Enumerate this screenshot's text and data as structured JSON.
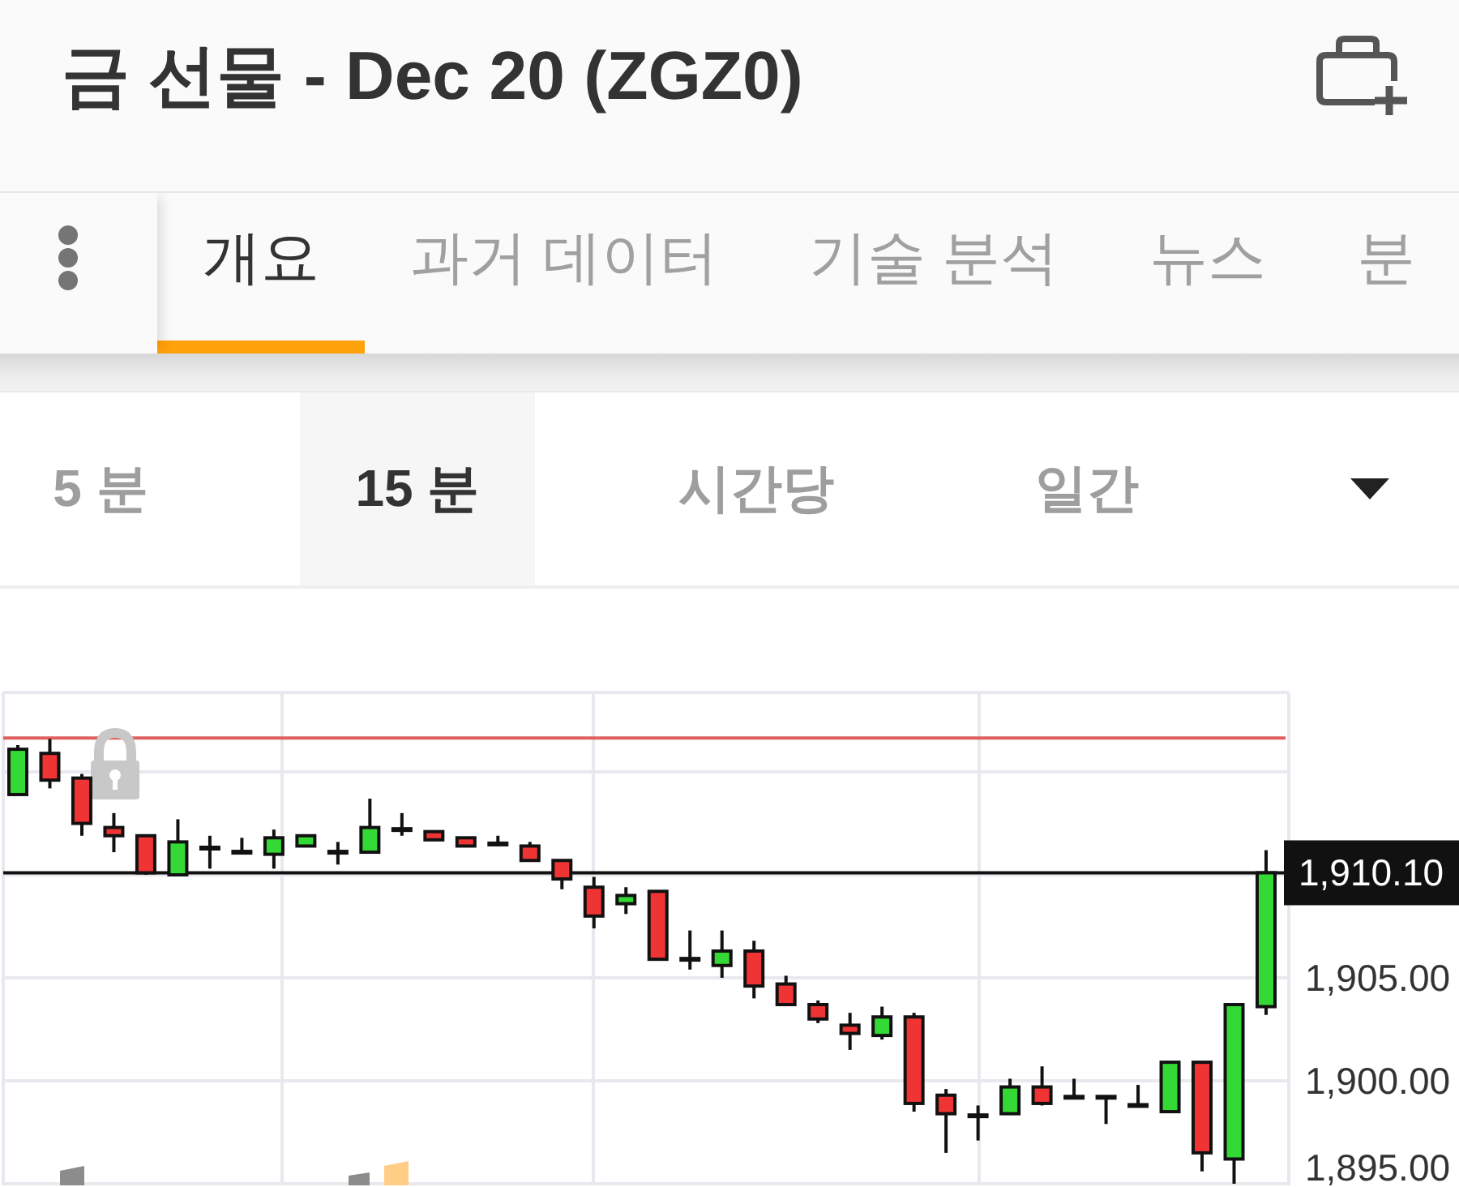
{
  "header": {
    "title": "금 선물 - Dec 20 (ZGZ0)"
  },
  "tabs": [
    {
      "label": "개요",
      "selected": true
    },
    {
      "label": "과거 데이터",
      "selected": false
    },
    {
      "label": "기술 분석",
      "selected": false
    },
    {
      "label": "뉴스",
      "selected": false
    },
    {
      "label": "분",
      "selected": false
    }
  ],
  "intervals": [
    {
      "label": "5 분",
      "selected": false
    },
    {
      "label": "15 분",
      "selected": true
    },
    {
      "label": "시간당",
      "selected": false
    },
    {
      "label": "일간",
      "selected": false
    }
  ],
  "chart": {
    "chart_data": {
      "type": "candlestick",
      "categories": [
        null,
        null,
        null,
        null,
        null,
        null,
        null,
        null,
        null,
        null,
        null,
        null,
        null,
        null,
        null,
        null,
        null,
        null,
        null,
        null,
        null,
        null,
        null,
        null,
        null,
        null,
        null,
        null,
        null,
        null,
        null,
        null,
        null,
        null,
        null,
        null,
        null,
        null,
        null,
        null
      ],
      "ohlc": [
        [
          1913.9,
          1916.3,
          1913.9,
          1916.1
        ],
        [
          1915.9,
          1916.6,
          1914.2,
          1914.6
        ],
        [
          1914.7,
          1914.9,
          1911.9,
          1912.5
        ],
        [
          1912.3,
          1913.0,
          1911.1,
          1911.9
        ],
        [
          1911.9,
          1911.9,
          1910.0,
          1910.1
        ],
        [
          1910.0,
          1912.7,
          1910.0,
          1911.6
        ],
        [
          1911.3,
          1911.9,
          1910.3,
          1911.3
        ],
        [
          1911.1,
          1911.8,
          1911.1,
          1911.1
        ],
        [
          1911.0,
          1912.2,
          1910.3,
          1911.8
        ],
        [
          1911.4,
          1911.9,
          1911.4,
          1911.9
        ],
        [
          1911.1,
          1911.6,
          1910.5,
          1911.1
        ],
        [
          1911.1,
          1913.7,
          1911.1,
          1912.3
        ],
        [
          1912.2,
          1913.0,
          1911.9,
          1912.2
        ],
        [
          1912.1,
          1912.1,
          1911.7,
          1911.7
        ],
        [
          1911.8,
          1911.8,
          1911.4,
          1911.4
        ],
        [
          1911.5,
          1911.9,
          1911.5,
          1911.5
        ],
        [
          1911.4,
          1911.6,
          1910.7,
          1910.7
        ],
        [
          1910.7,
          1910.7,
          1909.3,
          1909.8
        ],
        [
          1909.4,
          1909.9,
          1907.4,
          1908.0
        ],
        [
          1908.6,
          1909.4,
          1908.1,
          1909.0
        ],
        [
          1909.2,
          1909.2,
          1905.9,
          1905.9
        ],
        [
          1905.9,
          1907.3,
          1905.4,
          1905.9
        ],
        [
          1905.6,
          1907.3,
          1905.0,
          1906.3
        ],
        [
          1906.3,
          1906.8,
          1904.0,
          1904.6
        ],
        [
          1904.7,
          1905.1,
          1903.7,
          1903.7
        ],
        [
          1903.7,
          1903.9,
          1902.8,
          1903.0
        ],
        [
          1902.7,
          1903.3,
          1901.5,
          1902.3
        ],
        [
          1902.2,
          1903.6,
          1902.0,
          1903.1
        ],
        [
          1903.1,
          1903.3,
          1898.5,
          1898.9
        ],
        [
          1899.3,
          1899.6,
          1896.5,
          1898.4
        ],
        [
          1898.3,
          1898.8,
          1897.1,
          1898.3
        ],
        [
          1898.4,
          1900.1,
          1898.4,
          1899.7
        ],
        [
          1899.7,
          1900.7,
          1898.8,
          1898.9
        ],
        [
          1899.2,
          1900.1,
          1899.2,
          1899.2
        ],
        [
          1899.2,
          1899.2,
          1897.9,
          1899.2
        ],
        [
          1898.8,
          1899.8,
          1898.8,
          1898.8
        ],
        [
          1898.5,
          1900.9,
          1898.5,
          1900.9
        ],
        [
          1900.9,
          1900.9,
          1895.6,
          1896.5
        ],
        [
          1896.2,
          1903.7,
          1895.0,
          1903.7
        ],
        [
          1903.6,
          1911.2,
          1903.2,
          1910.1
        ]
      ],
      "ylim": [
        1894.92,
        1918.86
      ],
      "yticks": [
        {
          "value": 1905,
          "label": "1,905.00"
        },
        {
          "value": 1900,
          "label": "1,900.00"
        },
        {
          "value": 1895,
          "label": "1,895.00"
        }
      ],
      "grid": true,
      "ref_lines": [
        {
          "axis": "y",
          "value": 1910.1,
          "label": "1,910.10",
          "color": "#111111"
        },
        {
          "axis": "y",
          "value": 1916.65,
          "color": "#e06060"
        }
      ]
    }
  }
}
